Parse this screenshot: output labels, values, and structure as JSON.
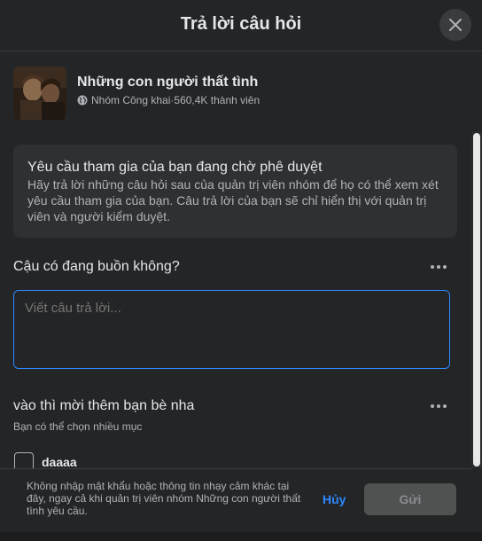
{
  "dialog": {
    "title": "Trả lời câu hỏi"
  },
  "group": {
    "name": "Những con người thất tình",
    "privacy": "Nhóm Công khai",
    "separator": " · ",
    "members": "560,4K thành viên"
  },
  "notice": {
    "title": "Yêu cầu tham gia của bạn đang chờ phê duyệt",
    "body": "Hãy trả lời những câu hỏi sau của quản trị viên nhóm để họ có thể xem xét yêu cầu tham gia của bạn. Câu trả lời của bạn sẽ chỉ hiển thị với quản trị viên và người kiểm duyệt."
  },
  "questions": [
    {
      "text": "Cậu có đang buồn không?",
      "placeholder": "Viết câu trả lời..."
    },
    {
      "text": "vào thì mời thêm bạn bè nha",
      "hint": "Bạn có thể chọn nhiều mục",
      "options": [
        {
          "label": "daaaa",
          "checked": false
        }
      ]
    }
  ],
  "footer": {
    "note": "Không nhập mật khẩu hoặc thông tin nhạy cảm khác tại đây, ngay cả khi quản trị viên nhóm Những con người thất tình yêu cầu.",
    "cancel": "Hủy",
    "submit": "Gửi"
  },
  "colors": {
    "accent": "#2d88ff",
    "background": "#242526",
    "surface": "#3a3b3c"
  },
  "icons": {
    "close": "close-icon",
    "privacy": "globe-icon",
    "menu": "more-dots-icon"
  }
}
